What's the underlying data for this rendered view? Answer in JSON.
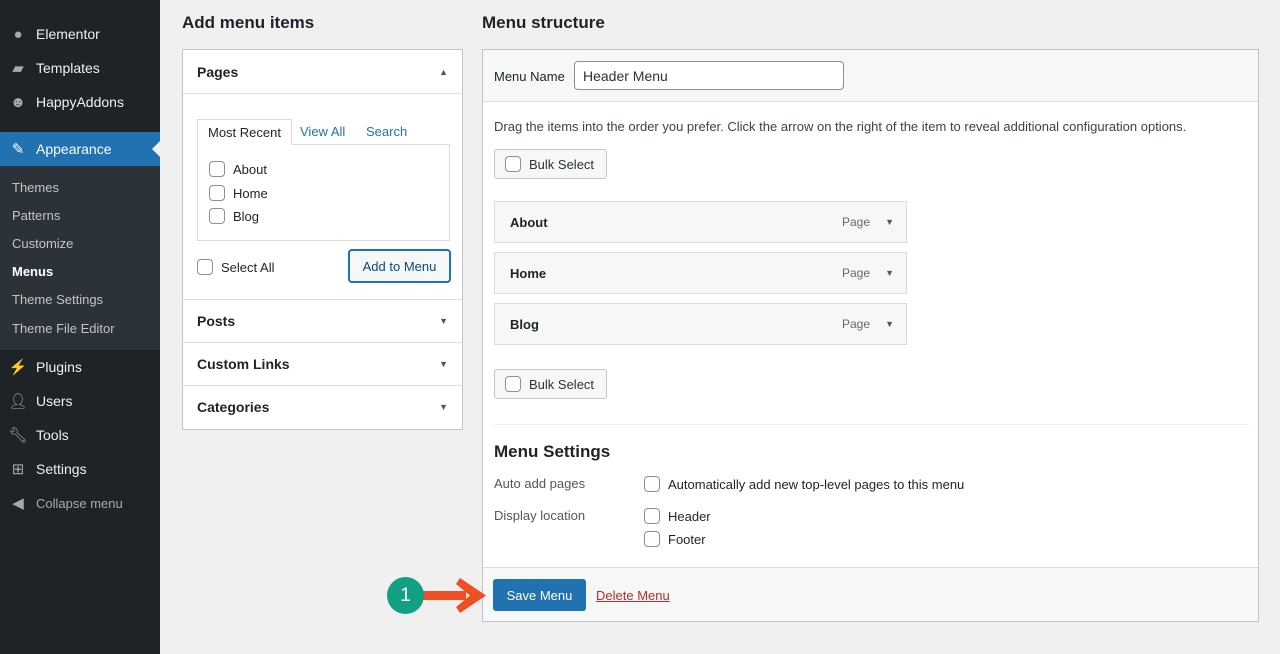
{
  "sidebar": {
    "items": [
      {
        "label": "Elementor",
        "icon": "elementor-icon"
      },
      {
        "label": "Templates",
        "icon": "folder-icon"
      },
      {
        "label": "HappyAddons",
        "icon": "happy-face-icon"
      },
      {
        "label": "Appearance",
        "icon": "paintbrush-icon"
      },
      {
        "label": "Plugins",
        "icon": "plug-icon"
      },
      {
        "label": "Users",
        "icon": "user-icon"
      },
      {
        "label": "Tools",
        "icon": "wrench-icon"
      },
      {
        "label": "Settings",
        "icon": "sliders-icon"
      },
      {
        "label": "Collapse menu",
        "icon": "collapse-icon"
      }
    ],
    "submenu": [
      "Themes",
      "Patterns",
      "Customize",
      "Menus",
      "Theme Settings",
      "Theme File Editor"
    ]
  },
  "add_items": {
    "title": "Add menu items",
    "pages_label": "Pages",
    "tabs": [
      "Most Recent",
      "View All",
      "Search"
    ],
    "pages": [
      "About",
      "Home",
      "Blog"
    ],
    "select_all": "Select All",
    "add_button": "Add to Menu",
    "sections": [
      "Posts",
      "Custom Links",
      "Categories"
    ]
  },
  "structure": {
    "title": "Menu structure",
    "menu_name_label": "Menu Name",
    "menu_name_value": "Header Menu",
    "instructions": "Drag the items into the order you prefer. Click the arrow on the right of the item to reveal additional configuration options.",
    "bulk_select": "Bulk Select",
    "items": [
      {
        "title": "About",
        "type": "Page"
      },
      {
        "title": "Home",
        "type": "Page"
      },
      {
        "title": "Blog",
        "type": "Page"
      }
    ],
    "settings_title": "Menu Settings",
    "auto_add_label": "Auto add pages",
    "auto_add_option": "Automatically add new top-level pages to this menu",
    "display_label": "Display location",
    "locations": [
      "Header",
      "Footer"
    ],
    "save_button": "Save Menu",
    "delete_link": "Delete Menu"
  },
  "annotation": {
    "step": "1",
    "colors": {
      "badge": "#12a084",
      "arrow": "#f04e23"
    }
  },
  "colors": {
    "accent": "#2271b1",
    "sidebar": "#1d2327",
    "delete": "#b32d2e"
  }
}
